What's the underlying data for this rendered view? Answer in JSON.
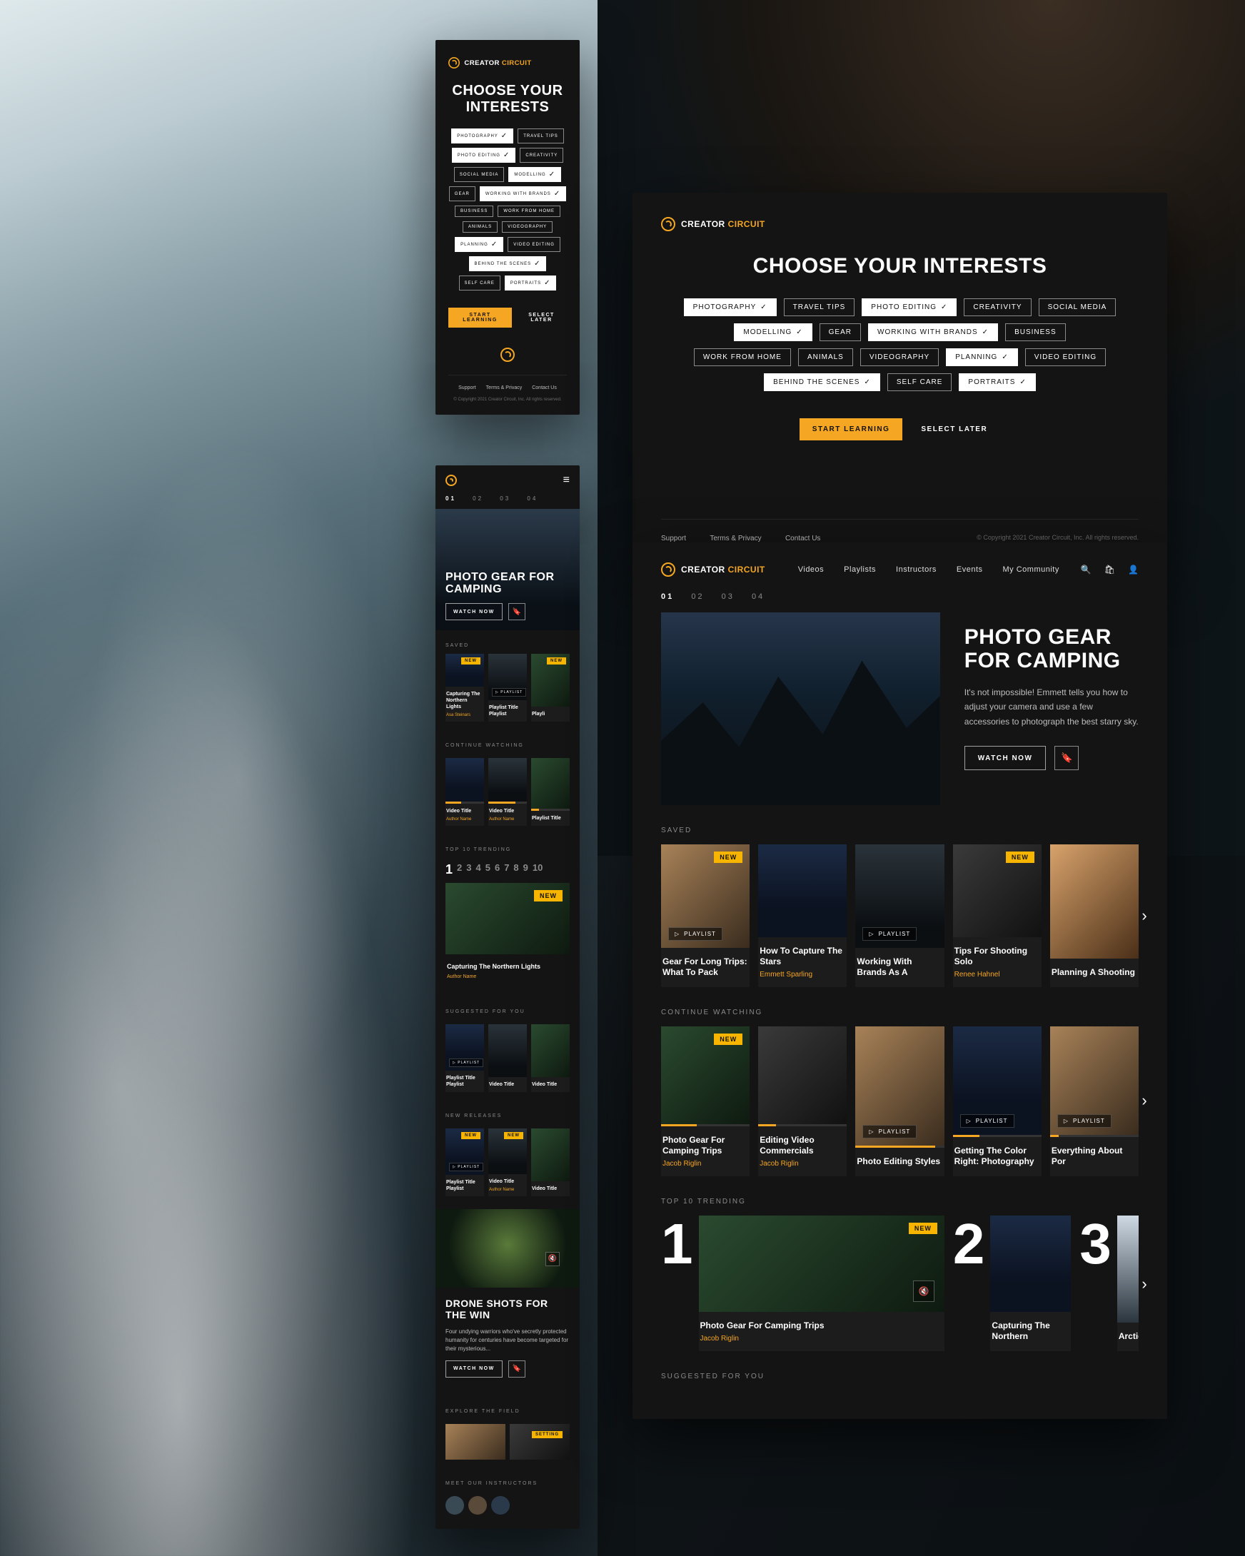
{
  "brand": {
    "a": "CREATOR",
    "b": "CIRCUIT"
  },
  "interests": {
    "heading": "CHOOSE YOUR INTERESTS",
    "tags": [
      {
        "label": "PHOTOGRAPHY",
        "sel": true
      },
      {
        "label": "TRAVEL TIPS",
        "sel": false
      },
      {
        "label": "PHOTO EDITING",
        "sel": true
      },
      {
        "label": "CREATIVITY",
        "sel": false
      },
      {
        "label": "SOCIAL MEDIA",
        "sel": false
      },
      {
        "label": "MODELLING",
        "sel": true
      },
      {
        "label": "GEAR",
        "sel": false
      },
      {
        "label": "WORKING WITH BRANDS",
        "sel": true
      },
      {
        "label": "BUSINESS",
        "sel": false
      },
      {
        "label": "WORK FROM HOME",
        "sel": false
      },
      {
        "label": "ANIMALS",
        "sel": false
      },
      {
        "label": "VIDEOGRAPHY",
        "sel": false
      },
      {
        "label": "PLANNING",
        "sel": true
      },
      {
        "label": "VIDEO EDITING",
        "sel": false
      },
      {
        "label": "BEHIND THE SCENES",
        "sel": true
      },
      {
        "label": "SELF CARE",
        "sel": false
      },
      {
        "label": "PORTRAITS",
        "sel": true
      }
    ],
    "cta_primary": "START LEARNING",
    "cta_secondary": "SELECT LATER"
  },
  "footer": {
    "links": [
      "Support",
      "Terms & Privacy",
      "Contact Us"
    ],
    "copyright": "© Copyright 2021 Creator Circuit, Inc. All rights reserved."
  },
  "nav": {
    "items": [
      "Videos",
      "Playlists",
      "Instructors",
      "Events",
      "My Community"
    ]
  },
  "tabs": [
    "01",
    "02",
    "03",
    "04"
  ],
  "hero": {
    "title": "PHOTO GEAR FOR CAMPING",
    "body": "It's not impossible! Emmett tells you how to adjust your camera and use a few accessories to photograph the best starry sky.",
    "watch": "WATCH NOW"
  },
  "sections": {
    "saved": "SAVED",
    "cont": "CONTINUE WATCHING",
    "top": "TOP 10 TRENDING",
    "sugg": "SUGGESTED FOR YOU",
    "new": "NEW RELEASES",
    "explore": "EXPLORE THE FIELD",
    "instr": "MEET OUR INSTRUCTORS"
  },
  "labels": {
    "new": "NEW",
    "playlist": "PLAYLIST",
    "setting": "SETTING"
  },
  "dash": {
    "saved": [
      {
        "title": "Gear For Long Trips: What To Pack",
        "author": "",
        "new": true,
        "playlist": true
      },
      {
        "title": "How To Capture The Stars",
        "author": "Emmett Sparling",
        "new": false,
        "playlist": false
      },
      {
        "title": "Working With Brands As A",
        "author": "",
        "new": false,
        "playlist": true
      },
      {
        "title": "Tips For Shooting Solo",
        "author": "Renee Hahnel",
        "new": true,
        "playlist": false
      },
      {
        "title": "Planning A Shooting",
        "author": "",
        "new": false,
        "playlist": false
      }
    ],
    "cont": [
      {
        "title": "Photo Gear For Camping Trips",
        "author": "Jacob Riglin",
        "new": true,
        "p": 40
      },
      {
        "title": "Editing Video Commercials",
        "author": "Jacob Riglin",
        "new": false,
        "p": 20
      },
      {
        "title": "Photo Editing Styles",
        "author": "",
        "new": false,
        "p": 90,
        "playlist": true
      },
      {
        "title": "Getting The Color Right: Photography",
        "author": "",
        "new": false,
        "p": 30,
        "playlist": true
      },
      {
        "title": "Everything About Por",
        "author": "",
        "new": false,
        "p": 10,
        "playlist": true
      }
    ],
    "top": [
      {
        "n": "1",
        "title": "Photo Gear For Camping Trips",
        "author": "Jacob Riglin",
        "new": true
      },
      {
        "n": "2",
        "title": "Capturing The Northern",
        "author": ""
      },
      {
        "n": "3",
        "title": "Arctic",
        "author": ""
      }
    ]
  },
  "mobile": {
    "hero_title": "PHOTO GEAR FOR CAMPING",
    "watch": "WATCH NOW",
    "saved": [
      {
        "title": "Capturing The Northern Lights",
        "author": "Asa Steinars",
        "new": true
      },
      {
        "title": "Playlist Title Playlist",
        "author": "",
        "playlist": true
      },
      {
        "title": "Playli",
        "new": true
      }
    ],
    "cont": [
      {
        "title": "Video Title",
        "author": "Author Name",
        "p": 40
      },
      {
        "title": "Video Title",
        "author": "Author Name",
        "p": 70
      },
      {
        "title": "Playlist Title",
        "p": 20
      }
    ],
    "top_nums": [
      "1",
      "2",
      "3",
      "4",
      "5",
      "6",
      "7",
      "8",
      "9",
      "10"
    ],
    "top_title": "Capturing The Northern Lights",
    "top_author": "Author Name",
    "sugg": [
      {
        "title": "Playlist Title Playlist",
        "playlist": true
      },
      {
        "title": "Video Title"
      },
      {
        "title": "Video Title"
      }
    ],
    "newr": [
      {
        "title": "Playlist Title Playlist",
        "new": true,
        "playlist": true
      },
      {
        "title": "Video Title",
        "author": "Author Name",
        "new": true
      },
      {
        "title": "Video Title"
      }
    ],
    "drone": {
      "title": "DRONE SHOTS FOR THE WIN",
      "body": "Four undying warriors who've secretly protected humanity for centuries have become targeted for their mysterious...",
      "watch": "WATCH NOW"
    }
  }
}
